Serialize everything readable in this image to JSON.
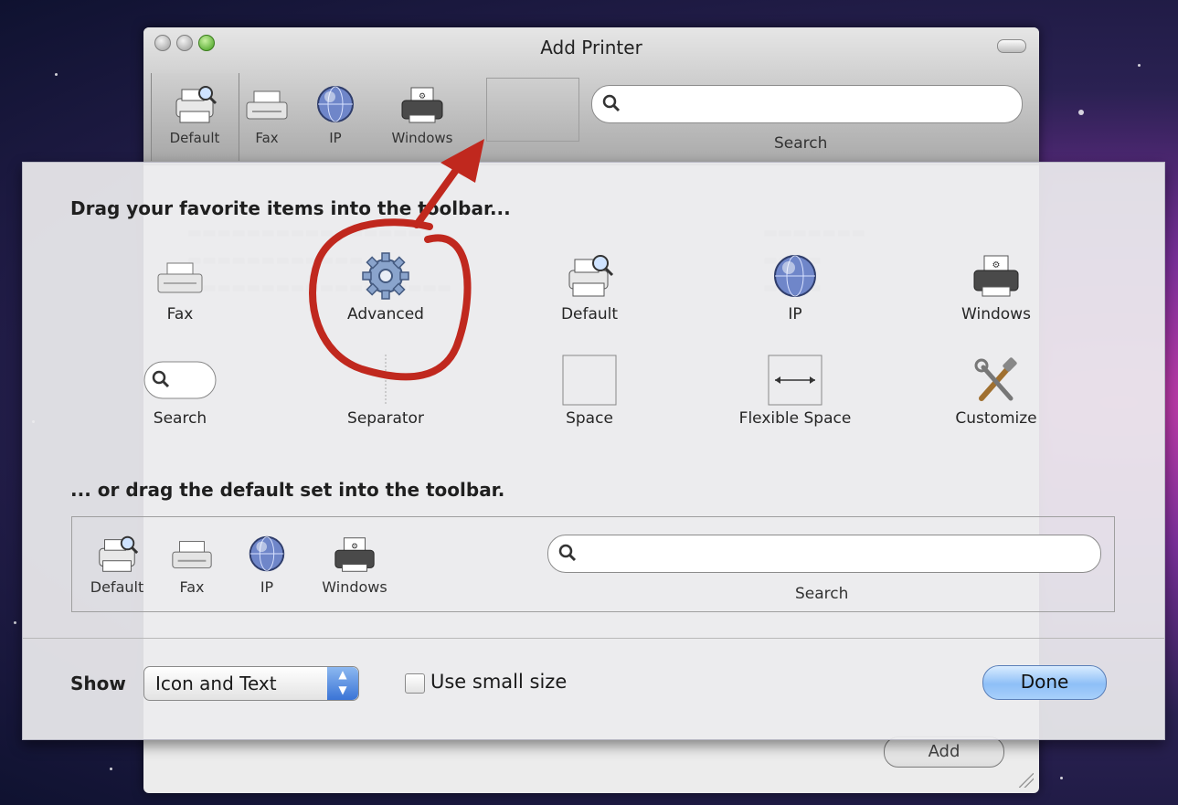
{
  "window": {
    "title": "Add Printer",
    "toolbar": [
      {
        "label": "Default",
        "icon": "printer-magnify-icon"
      },
      {
        "label": "Fax",
        "icon": "fax-icon"
      },
      {
        "label": "IP",
        "icon": "globe-icon"
      },
      {
        "label": "Windows",
        "icon": "windows-printer-icon"
      }
    ],
    "search_label": "Search",
    "add_label": "Add"
  },
  "sheet": {
    "heading_drag": "Drag your favorite items into the toolbar...",
    "palette": [
      {
        "label": "Fax",
        "icon": "fax-icon"
      },
      {
        "label": "Advanced",
        "icon": "gear-icon"
      },
      {
        "label": "Default",
        "icon": "printer-magnify-icon"
      },
      {
        "label": "IP",
        "icon": "globe-icon"
      },
      {
        "label": "Windows",
        "icon": "windows-printer-icon"
      },
      {
        "label": "Search",
        "icon": "search-field-icon"
      },
      {
        "label": "Separator",
        "icon": "separator-icon"
      },
      {
        "label": "Space",
        "icon": "space-icon"
      },
      {
        "label": "Flexible Space",
        "icon": "flexible-space-icon"
      },
      {
        "label": "Customize",
        "icon": "tools-icon"
      }
    ],
    "heading_default": "... or drag the default set into the toolbar.",
    "default_set": [
      {
        "label": "Default",
        "icon": "printer-magnify-icon"
      },
      {
        "label": "Fax",
        "icon": "fax-icon"
      },
      {
        "label": "IP",
        "icon": "globe-icon"
      },
      {
        "label": "Windows",
        "icon": "windows-printer-icon"
      }
    ],
    "default_search_label": "Search",
    "show_label": "Show",
    "show_value": "Icon and Text",
    "small_size_label": "Use small size",
    "done_label": "Done"
  },
  "annotation_color": "#c0281e"
}
